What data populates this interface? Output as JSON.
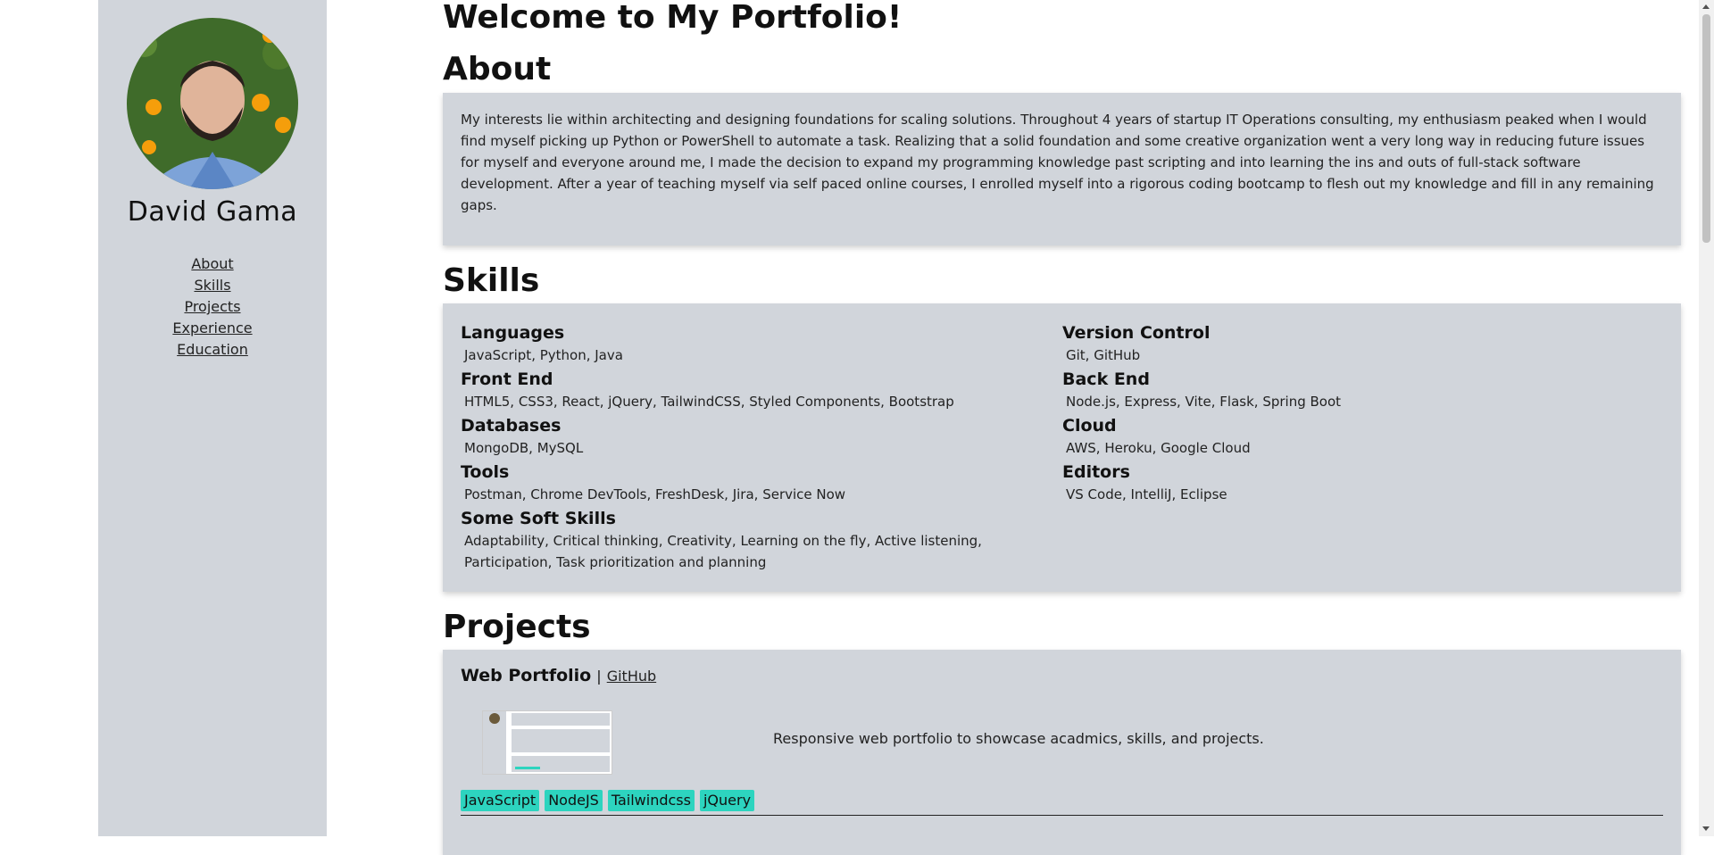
{
  "sidebar": {
    "name": "David Gama",
    "avatar_icon": "profile-photo",
    "nav": [
      "About",
      "Skills",
      "Projects",
      "Experience",
      "Education"
    ]
  },
  "main": {
    "title": "Welcome to My Portfolio!",
    "about": {
      "heading": "About",
      "text": "My interests lie within architecting and designing foundations for scaling solutions. Throughout 4 years of startup IT Operations consulting, my enthusiasm peaked when I would find myself picking up Python or PowerShell to automate a task. Realizing that a solid foundation and some creative organization went a very long way in reducing future issues for myself and everyone around me, I made the decision to expand my programming knowledge past scripting and into learning the ins and outs of full-stack software development. After a year of teaching myself via self paced online courses, I enrolled myself into a rigorous coding bootcamp to flesh out my knowledge and fill in any remaining gaps."
    },
    "skills": {
      "heading": "Skills",
      "items": [
        {
          "title": "Languages",
          "list": "JavaScript, Python, Java"
        },
        {
          "title": "Front End",
          "list": "HTML5, CSS3, React, jQuery, TailwindCSS, Styled Components, Bootstrap"
        },
        {
          "title": "Databases",
          "list": "MongoDB, MySQL"
        },
        {
          "title": "Tools",
          "list": "Postman, Chrome DevTools, FreshDesk, Jira, Service Now"
        },
        {
          "title": "Some Soft Skills",
          "list": "Adaptability, Critical thinking, Creativity, Learning on the fly, Active listening, Participation, Task prioritization and planning"
        },
        {
          "title": "Version Control",
          "list": "Git, GitHub"
        },
        {
          "title": "Back End",
          "list": "Node.js, Express, Vite, Flask, Spring Boot"
        },
        {
          "title": "Cloud",
          "list": "AWS, Heroku, Google Cloud"
        },
        {
          "title": "Editors",
          "list": "VS Code, IntelliJ, Eclipse"
        }
      ]
    },
    "projects": {
      "heading": "Projects",
      "items": [
        {
          "title": "Web Portfolio",
          "separator": "|",
          "link": "GitHub",
          "description": "Responsive web portfolio to showcase acadmics, skills, and projects.",
          "tags": [
            "JavaScript",
            "NodeJS",
            "Tailwindcss",
            "jQuery"
          ]
        }
      ]
    }
  },
  "colors": {
    "card_bg": "#d1d5db",
    "tag_bg": "#2dd4bf",
    "sidebar_bg": "#d1d5db"
  }
}
